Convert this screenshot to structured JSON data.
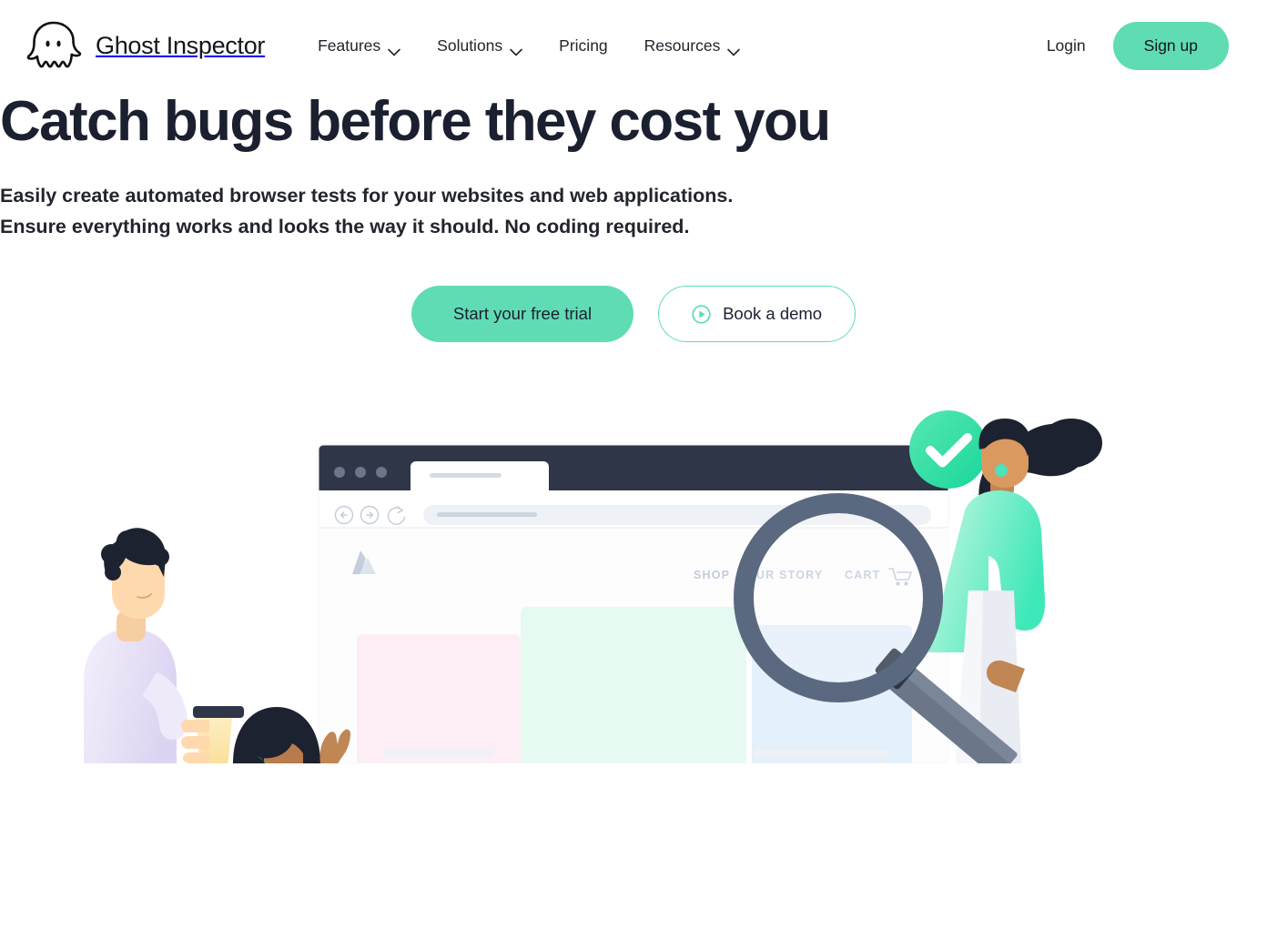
{
  "brand": {
    "name": "Ghost Inspector",
    "logo_icon": "ghost-icon"
  },
  "nav": {
    "items": [
      {
        "label": "Features",
        "has_dropdown": true,
        "icon": "chevron-down-icon"
      },
      {
        "label": "Solutions",
        "has_dropdown": true,
        "icon": "chevron-down-icon"
      },
      {
        "label": "Pricing",
        "has_dropdown": false,
        "icon": ""
      },
      {
        "label": "Resources",
        "has_dropdown": true,
        "icon": "chevron-down-icon"
      }
    ]
  },
  "header_actions": {
    "login_label": "Login",
    "signup_label": "Sign up"
  },
  "hero": {
    "title": "Catch bugs before they cost you",
    "subtitle_line1": "Easily create automated browser tests for your websites and web applications.",
    "subtitle_line2": "Ensure everything works and looks the way it should. No coding required.",
    "primary_cta": "Start your free trial",
    "secondary_cta": "Book a demo",
    "secondary_cta_icon": "play-circle-icon"
  },
  "illustration": {
    "browser_mock": {
      "tab_placeholder": "",
      "url_placeholder": "",
      "back_icon": "arrow-left-circle-icon",
      "forward_icon": "arrow-right-circle-icon",
      "reload_icon": "refresh-icon",
      "shop_logo_icon": "shop-logo-icon",
      "nav_links": [
        "SHOP",
        "OUR STORY",
        "CART"
      ],
      "cart_icon": "shopping-cart-icon"
    },
    "success_badge_icon": "check-circle-icon",
    "magnifier_icon": "magnifying-glass-icon",
    "characters": [
      "person-with-coffee",
      "seated-person",
      "person-with-magnifier"
    ]
  },
  "colors": {
    "accent_green": "#5FDCB3",
    "accent_green_dark": "#2ED9A0",
    "text_dark": "#1b2030",
    "browser_chrome": "#2e3648",
    "magnifier_slate": "#5b6980",
    "card_pink": "#fdeef6",
    "card_mint": "#e6faf2",
    "card_blue": "#e4f0fb"
  }
}
